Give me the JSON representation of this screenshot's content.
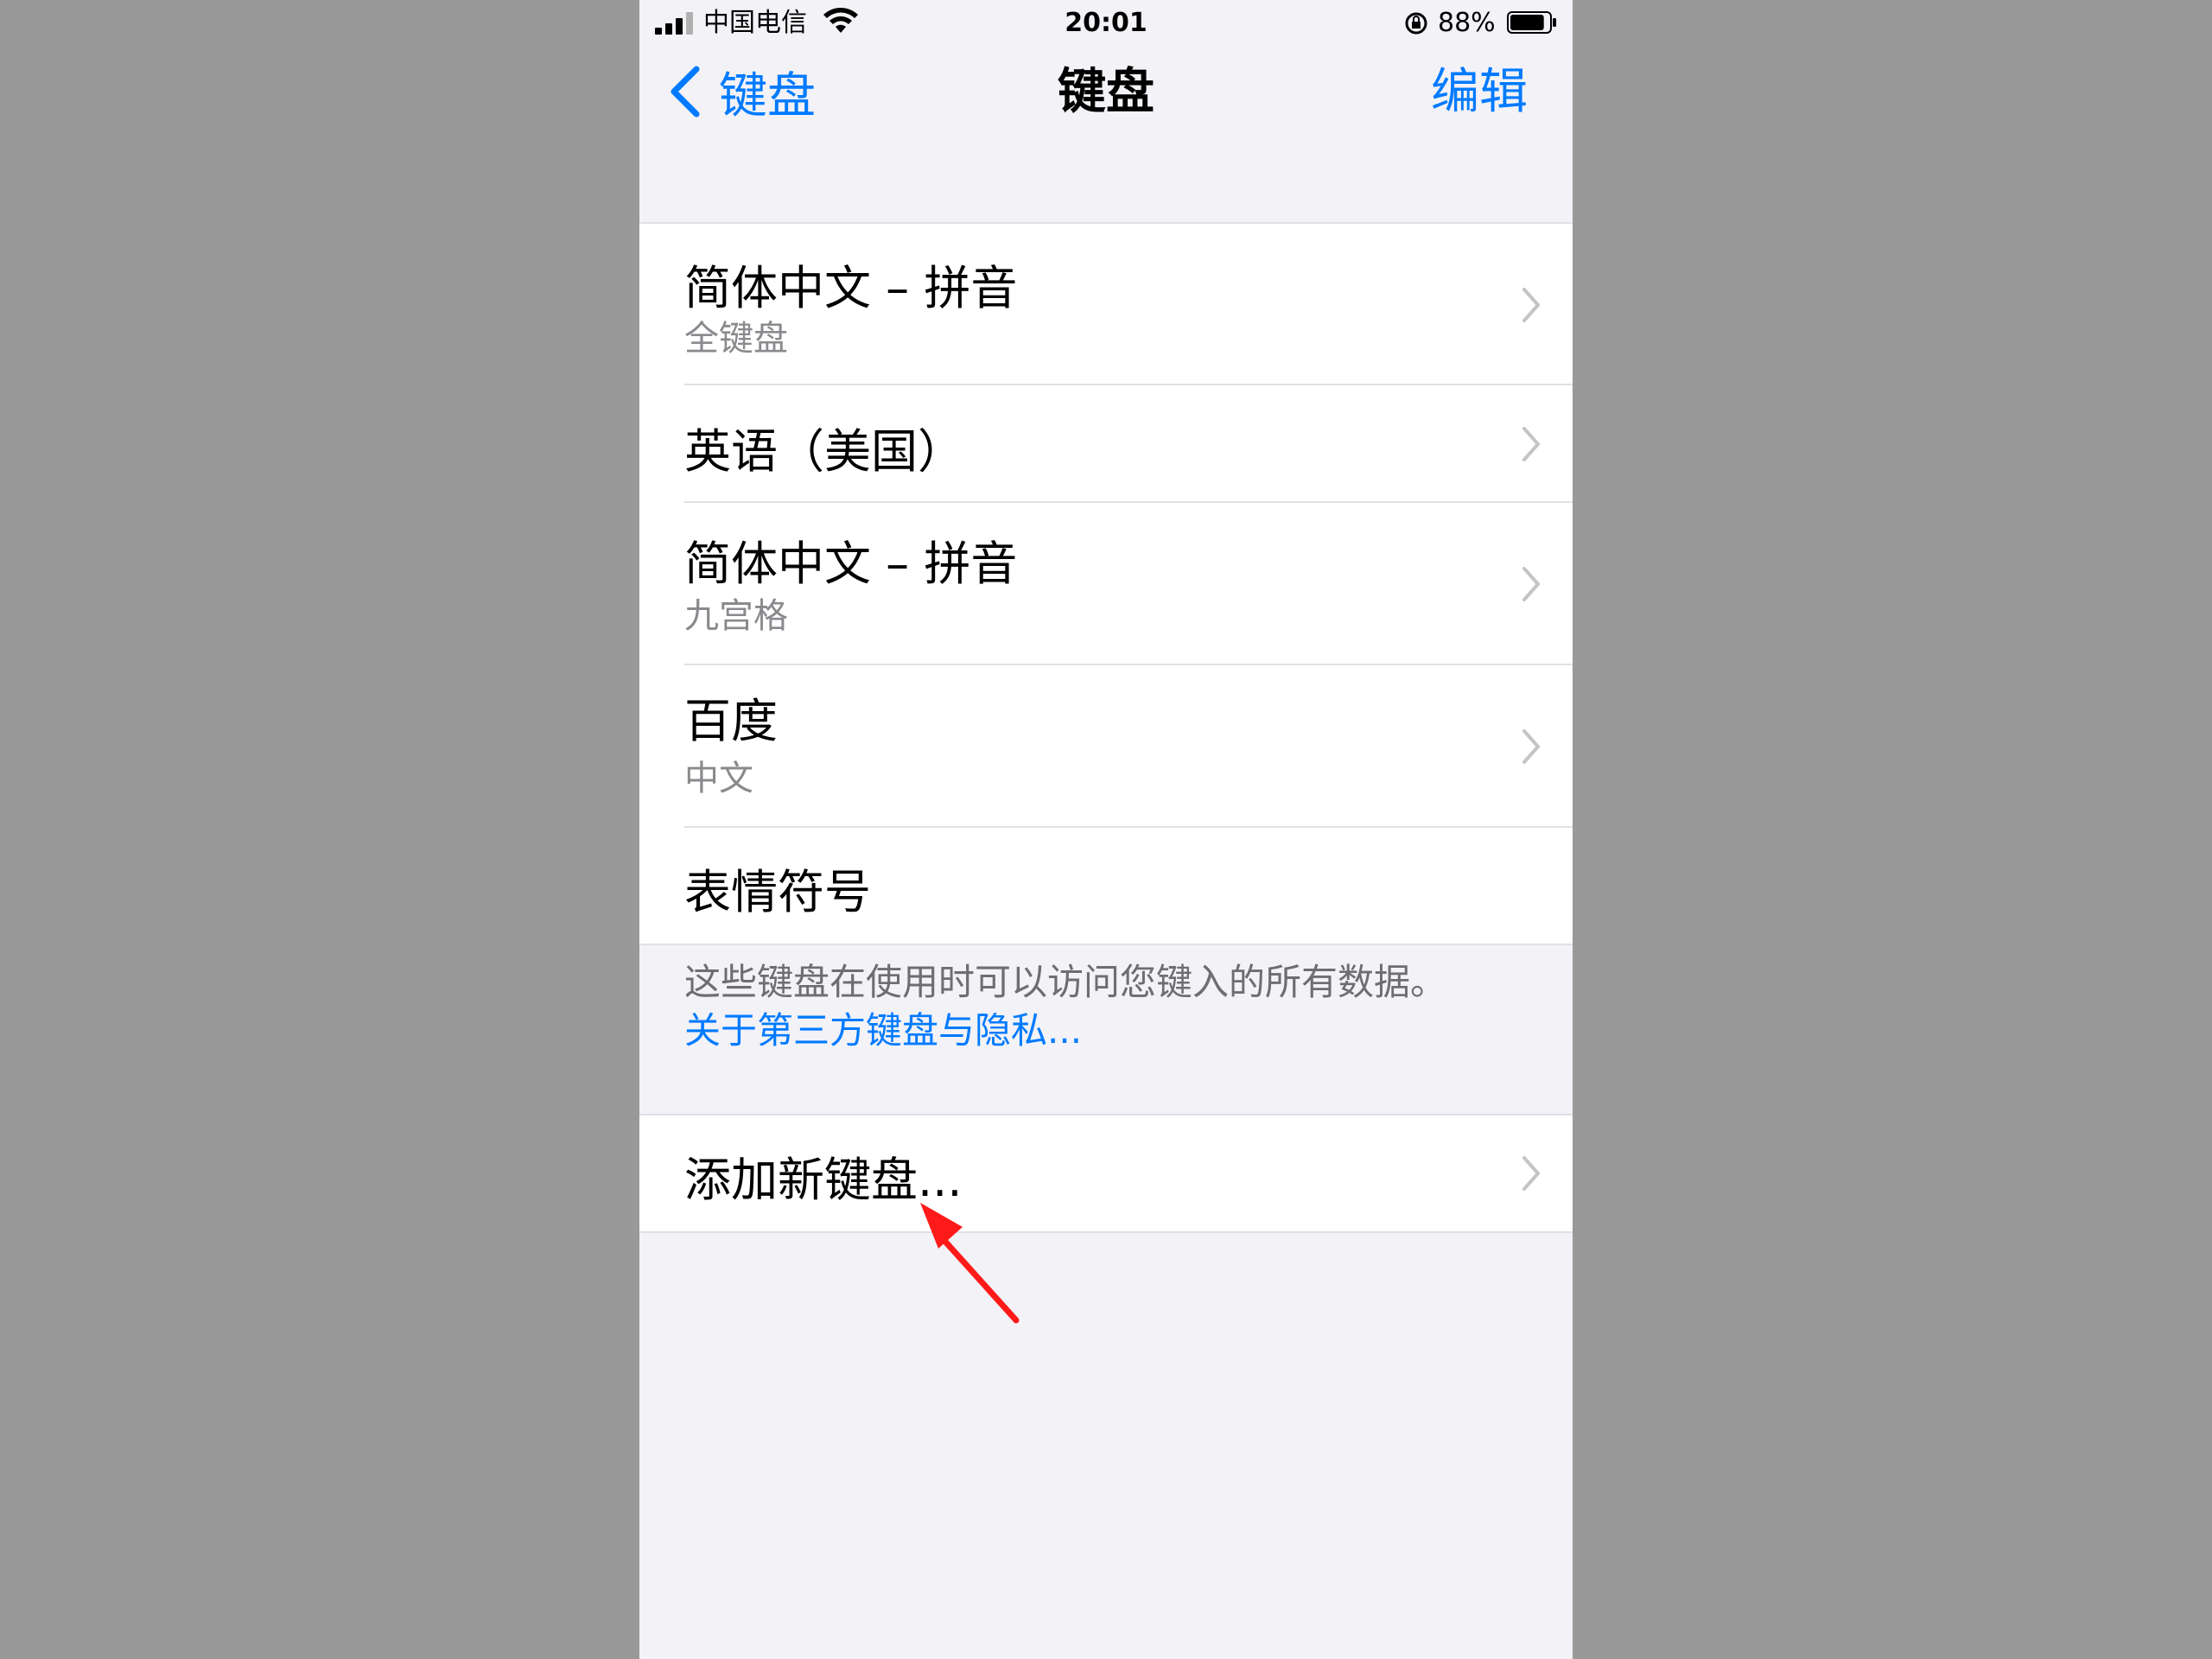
{
  "status_bar": {
    "carrier": "中国电信",
    "time": "20:01",
    "battery": "88%",
    "battery_level": 0.88
  },
  "nav": {
    "back_label": "键盘",
    "title": "键盘",
    "edit_label": "编辑"
  },
  "keyboards": [
    {
      "title": "简体中文 – 拼音",
      "subtitle": "全键盘"
    },
    {
      "title": "英语（美国）",
      "subtitle": ""
    },
    {
      "title": "简体中文 – 拼音",
      "subtitle": "九宫格"
    },
    {
      "title": "百度",
      "subtitle": "中文"
    },
    {
      "title": "表情符号",
      "subtitle": ""
    }
  ],
  "footer": {
    "note": "这些键盘在使用时可以访问您键入的所有数据。",
    "link": "关于第三方键盘与隐私..."
  },
  "add_keyboard": {
    "label": "添加新键盘..."
  },
  "colors": {
    "accent": "#007aff",
    "annotation_arrow": "#ff1a1a",
    "background": "#f2f2f7"
  }
}
